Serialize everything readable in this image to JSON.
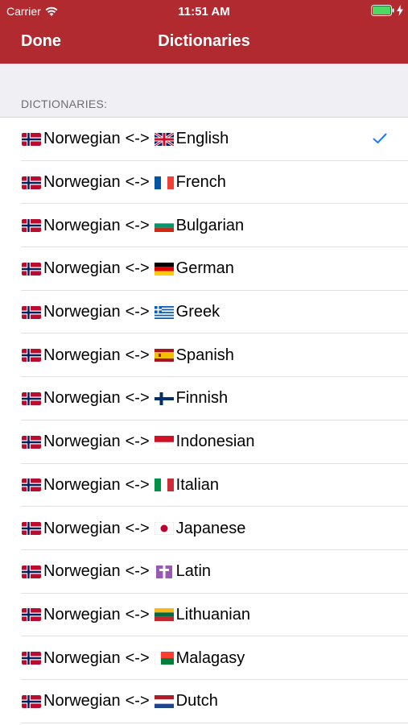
{
  "status_bar": {
    "carrier": "Carrier",
    "time": "11:51 AM"
  },
  "nav": {
    "done_label": "Done",
    "title": "Dictionaries"
  },
  "section": {
    "title": "DICTIONARIES:"
  },
  "colors": {
    "header": "#B02A2F",
    "check": "#1C7CF2",
    "battery": "#4CD964"
  },
  "dictionaries": [
    {
      "source": "Norwegian",
      "separator": "<->",
      "target": "English",
      "source_flag": "flag-norway-icon",
      "target_flag": "flag-uk-icon",
      "selected": true
    },
    {
      "source": "Norwegian",
      "separator": "<->",
      "target": "French",
      "source_flag": "flag-norway-icon",
      "target_flag": "flag-france-icon",
      "selected": false
    },
    {
      "source": "Norwegian",
      "separator": "<->",
      "target": "Bulgarian",
      "source_flag": "flag-norway-icon",
      "target_flag": "flag-bulgaria-icon",
      "selected": false
    },
    {
      "source": "Norwegian",
      "separator": "<->",
      "target": "German",
      "source_flag": "flag-norway-icon",
      "target_flag": "flag-germany-icon",
      "selected": false
    },
    {
      "source": "Norwegian",
      "separator": "<->",
      "target": "Greek",
      "source_flag": "flag-norway-icon",
      "target_flag": "flag-greece-icon",
      "selected": false
    },
    {
      "source": "Norwegian",
      "separator": "<->",
      "target": "Spanish",
      "source_flag": "flag-norway-icon",
      "target_flag": "flag-spain-icon",
      "selected": false
    },
    {
      "source": "Norwegian",
      "separator": "<->",
      "target": "Finnish",
      "source_flag": "flag-norway-icon",
      "target_flag": "flag-finland-icon",
      "selected": false
    },
    {
      "source": "Norwegian",
      "separator": "<->",
      "target": "Indonesian",
      "source_flag": "flag-norway-icon",
      "target_flag": "flag-indonesia-icon",
      "selected": false
    },
    {
      "source": "Norwegian",
      "separator": "<->",
      "target": "Italian",
      "source_flag": "flag-norway-icon",
      "target_flag": "flag-italy-icon",
      "selected": false
    },
    {
      "source": "Norwegian",
      "separator": "<->",
      "target": "Japanese",
      "source_flag": "flag-norway-icon",
      "target_flag": "flag-japan-icon",
      "selected": false
    },
    {
      "source": "Norwegian",
      "separator": "<->",
      "target": "Latin",
      "source_flag": "flag-norway-icon",
      "target_flag": "latin-cross-icon",
      "selected": false
    },
    {
      "source": "Norwegian",
      "separator": "<->",
      "target": "Lithuanian",
      "source_flag": "flag-norway-icon",
      "target_flag": "flag-lithuania-icon",
      "selected": false
    },
    {
      "source": "Norwegian",
      "separator": "<->",
      "target": "Malagasy",
      "source_flag": "flag-norway-icon",
      "target_flag": "flag-madagascar-icon",
      "selected": false
    },
    {
      "source": "Norwegian",
      "separator": "<->",
      "target": "Dutch",
      "source_flag": "flag-norway-icon",
      "target_flag": "flag-netherlands-icon",
      "selected": false
    }
  ]
}
